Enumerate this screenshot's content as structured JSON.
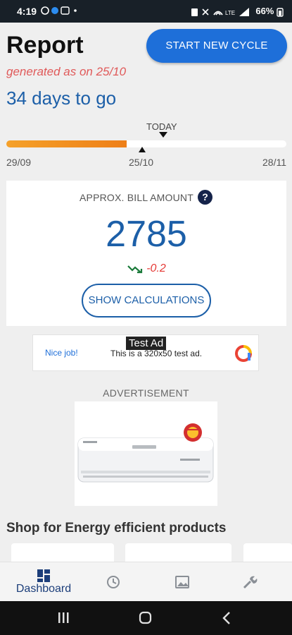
{
  "status_bar": {
    "time": "4:19",
    "battery": "66%"
  },
  "header": {
    "title": "Report",
    "generated": "generated as on 25/10",
    "days_to_go": "34 days to go",
    "start_button": "START NEW CYCLE"
  },
  "cycle": {
    "today_label": "TODAY",
    "start_date": "29/09",
    "generated_date": "25/10",
    "end_date": "28/11",
    "progress_fraction": 0.43
  },
  "bill_card": {
    "label": "APPROX. BILL AMOUNT",
    "amount": "2785",
    "change": "-0.2",
    "calc_button": "SHOW CALCULATIONS"
  },
  "ad_banner": {
    "left_text": "Nice job!",
    "badge": "Test Ad",
    "text": "This is a 320x50 test ad."
  },
  "advertisement_label": "ADVERTISEMENT",
  "shop": {
    "title": "Shop for Energy efficient products"
  },
  "bottom_nav": {
    "items": [
      {
        "label": "Dashboard",
        "icon": "dashboard-icon",
        "active": true
      },
      {
        "label": "",
        "icon": "history-icon",
        "active": false
      },
      {
        "label": "",
        "icon": "gallery-icon",
        "active": false
      },
      {
        "label": "",
        "icon": "settings-icon",
        "active": false
      }
    ]
  },
  "colors": {
    "accent": "#1e6fd9",
    "brand_blue": "#1c5fa8",
    "progress_orange": "#ee7f18",
    "negative_red": "#e53935",
    "trend_green": "#1a7a3a"
  }
}
